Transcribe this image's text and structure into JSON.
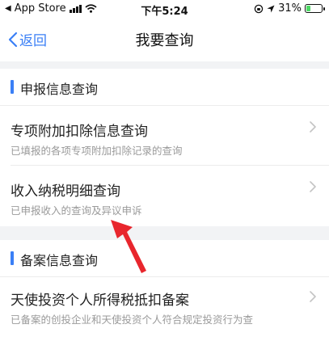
{
  "status_bar": {
    "carrier": "App Store",
    "time": "下午5:24",
    "battery_percent": "31%"
  },
  "nav": {
    "back_label": "返回",
    "title": "我要查询"
  },
  "sections": [
    {
      "title": "申报信息查询",
      "items": [
        {
          "title": "专项附加扣除信息查询",
          "desc": "已填报的各项专项附加扣除记录的查询"
        },
        {
          "title": "收入纳税明细查询",
          "desc": "已申报收入的查询及异议申诉"
        }
      ]
    },
    {
      "title": "备案信息查询",
      "items": [
        {
          "title": "天使投资个人所得税抵扣备案",
          "desc": "已备案的创投企业和天使投资个人符合规定投资行为查"
        }
      ]
    }
  ],
  "colors": {
    "accent": "#3a7ff6",
    "annotation_arrow": "#e8262d",
    "battery": "#4cd964"
  },
  "battery_level": 0.31
}
